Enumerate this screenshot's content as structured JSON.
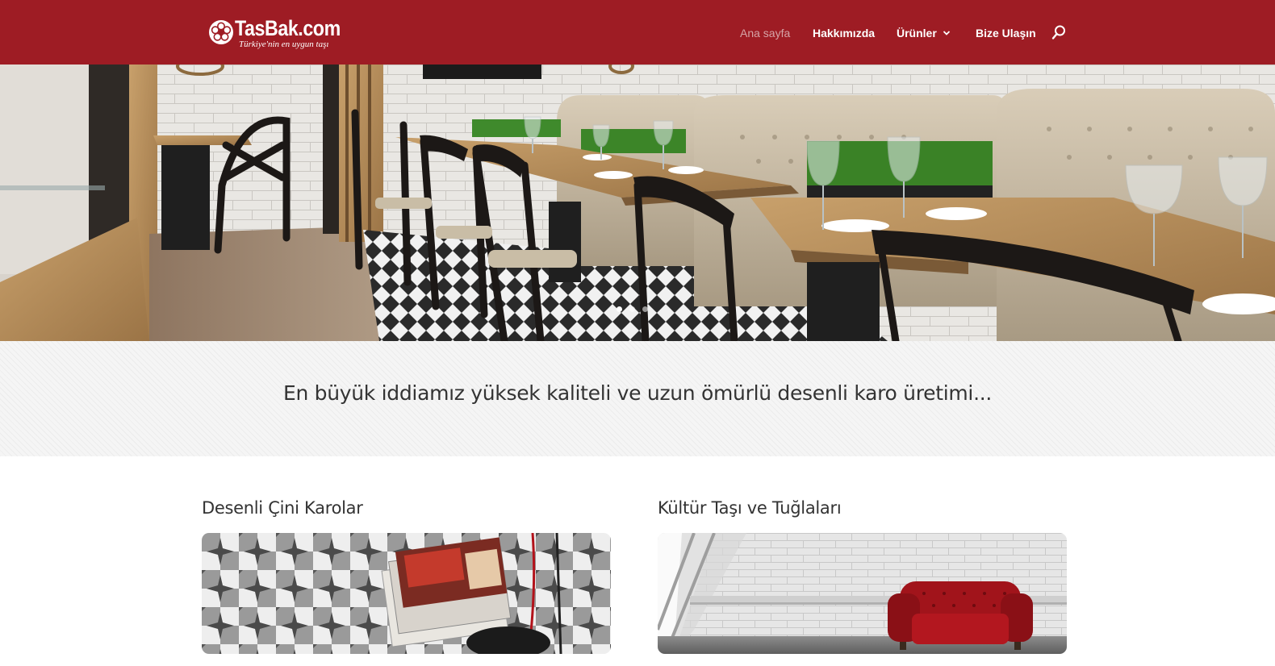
{
  "header": {
    "logo_text": "TasBak.com",
    "logo_tagline": "Türkiye'nin en uygun taşı",
    "bg_color": "#9e1c24",
    "nav": [
      {
        "label": "Ana sayfa",
        "active": true
      },
      {
        "label": "Hakkımızda",
        "active": false
      },
      {
        "label": "Ürünler",
        "active": false,
        "has_dropdown": true
      },
      {
        "label": "Bize Ulaşın",
        "active": false
      }
    ],
    "search_icon": "search-icon"
  },
  "hero": {
    "image": "restaurant-interior-photo",
    "slides": 3,
    "current_slide": 1
  },
  "band": {
    "text": "En büyük iddiamız yüksek kaliteli ve uzun ömürlü desenli karo üretimi..."
  },
  "categories": [
    {
      "title": "Desenli Çini Karolar",
      "image": "patterned-cement-tiles-photo"
    },
    {
      "title": "Kültür Taşı ve Tuğlaları",
      "image": "white-brick-wall-red-armchair-photo"
    }
  ]
}
